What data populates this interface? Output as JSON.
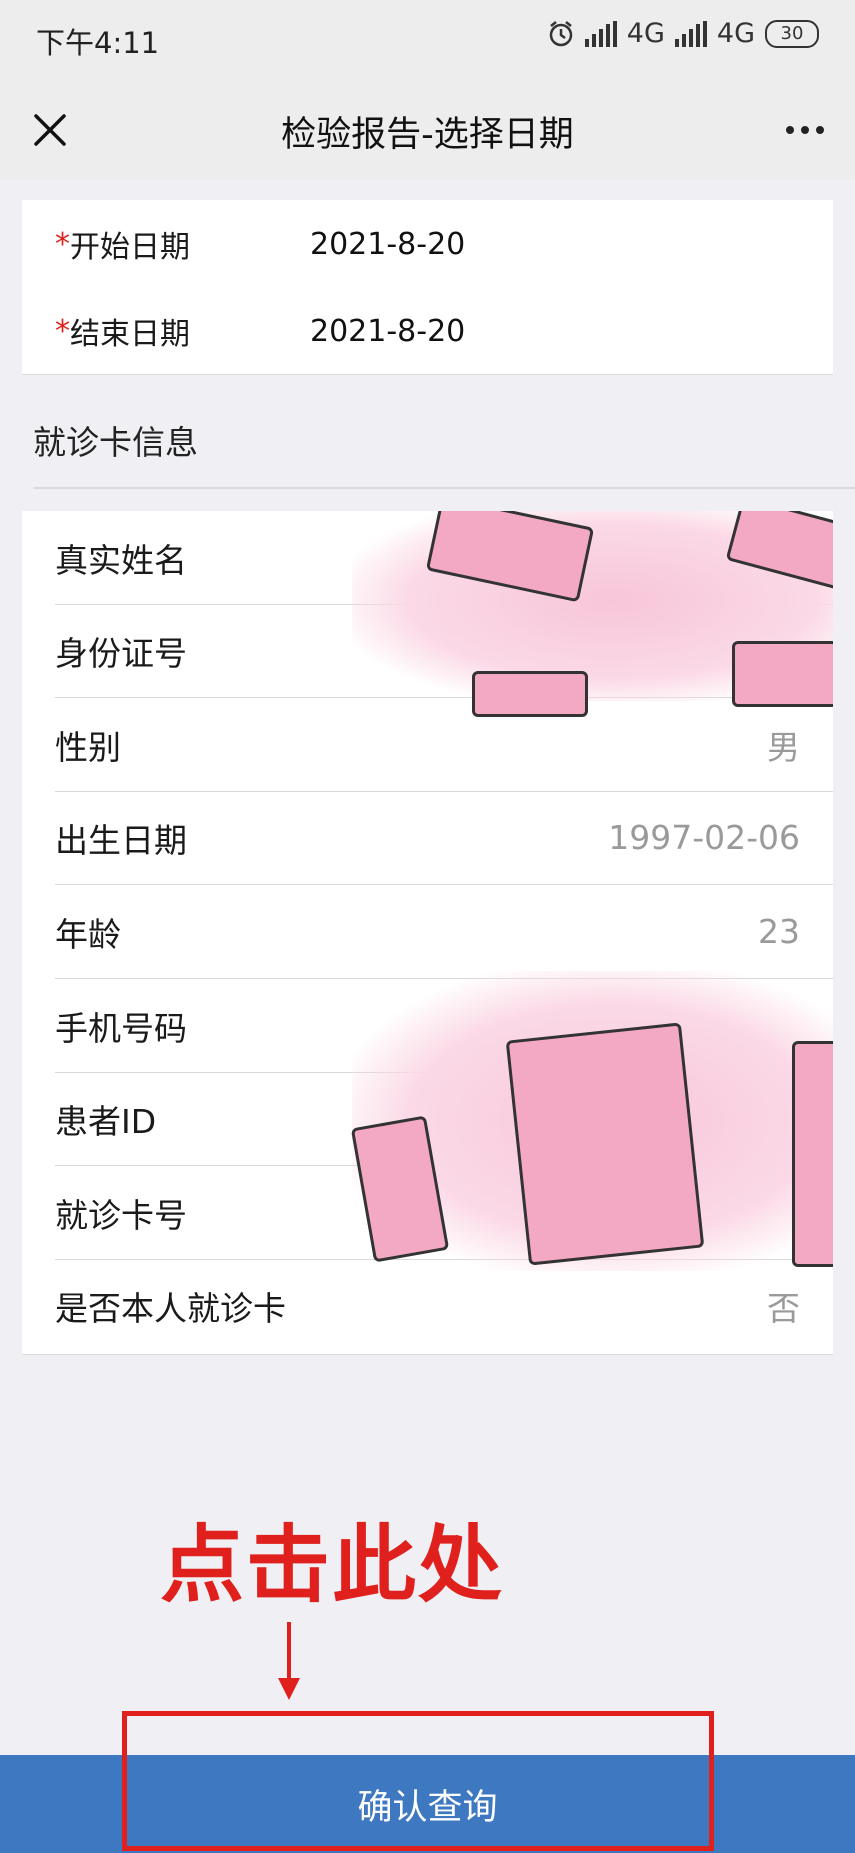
{
  "status_bar": {
    "time": "下午4:11",
    "network_1": "4G",
    "network_2": "4G",
    "battery": "30"
  },
  "nav": {
    "title": "检验报告-选择日期"
  },
  "date_form": {
    "start_label": "开始日期",
    "start_value": "2021-8-20",
    "end_label": "结束日期",
    "end_value": "2021-8-20",
    "required_mark": "*"
  },
  "card_section": {
    "title": "就诊卡信息",
    "rows": [
      {
        "label": "真实姓名",
        "value": ""
      },
      {
        "label": "身份证号",
        "value": ""
      },
      {
        "label": "性别",
        "value": "男"
      },
      {
        "label": "出生日期",
        "value": "1997-02-06"
      },
      {
        "label": "年龄",
        "value": "23"
      },
      {
        "label": "手机号码",
        "value": ""
      },
      {
        "label": "患者ID",
        "value": ""
      },
      {
        "label": "就诊卡号",
        "value": ""
      },
      {
        "label": "是否本人就诊卡",
        "value": "否"
      }
    ]
  },
  "annotation": {
    "hint": "点击此处"
  },
  "footer": {
    "confirm_label": "确认查询"
  },
  "colors": {
    "primary_button": "#3d78c0",
    "required_red": "#e0201c",
    "annotation_red": "#e0201c"
  }
}
